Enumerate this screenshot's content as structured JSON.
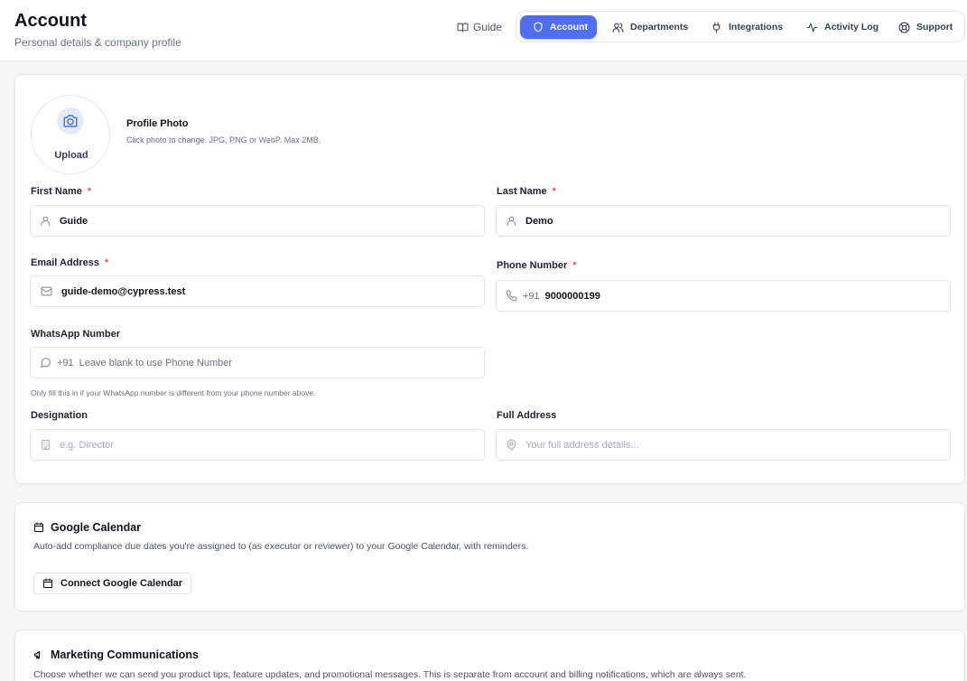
{
  "header": {
    "title": "Account",
    "subtitle": "Personal details & company profile",
    "guide_label": "Guide",
    "tabs": [
      {
        "label": "Account",
        "icon": "shield-icon",
        "active": true
      },
      {
        "label": "Departments",
        "icon": "users-icon",
        "active": false
      },
      {
        "label": "Integrations",
        "icon": "plug-icon",
        "active": false
      },
      {
        "label": "Activity Log",
        "icon": "activity-icon",
        "active": false
      },
      {
        "label": "Support",
        "icon": "lifebuoy-icon",
        "active": false
      }
    ]
  },
  "profile": {
    "upload_label": "Upload",
    "photo_title": "Profile Photo",
    "photo_hint": "Click photo to change. JPG, PNG or WebP. Max 2MB.",
    "first_name": {
      "label": "First Name",
      "required": "*",
      "value": "Guide"
    },
    "last_name": {
      "label": "Last Name",
      "required": "*",
      "value": "Demo"
    },
    "email": {
      "label": "Email Address",
      "required": "*",
      "value": "guide-demo@cypress.test"
    },
    "phone": {
      "label": "Phone Number",
      "required": "*",
      "prefix": "+91",
      "value": "9000000199"
    },
    "whatsapp": {
      "label": "WhatsApp Number",
      "prefix": "+91",
      "placeholder": "Leave blank to use Phone Number",
      "hint": "Only fill this in if your WhatsApp number is different from your phone number above."
    },
    "designation": {
      "label": "Designation",
      "placeholder": "e.g. Director"
    },
    "address": {
      "label": "Full Address",
      "placeholder": "Your full address details..."
    }
  },
  "google_calendar": {
    "title": "Google Calendar",
    "description": "Auto-add compliance due dates you're assigned to (as executor or reviewer) to your Google Calendar, with reminders.",
    "button_label": "Connect Google Calendar"
  },
  "marketing": {
    "title": "Marketing Communications",
    "description": "Choose whether we can send you product tips, feature updates, and promotional messages. This is separate from account and billing notifications, which are always sent."
  },
  "colors": {
    "accent": "#4f6ef2",
    "required": "#e0564c",
    "page_bg": "#f6f6f7"
  }
}
